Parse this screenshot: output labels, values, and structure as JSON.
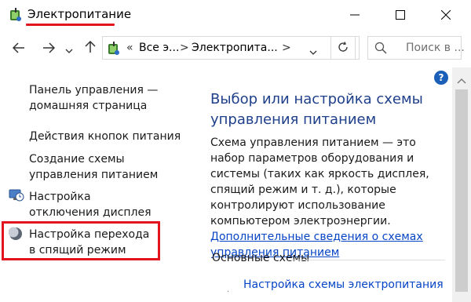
{
  "window": {
    "title": "Электропитание",
    "accent_color": "#e2151e",
    "controls": {
      "minimize_icon": "minimize-icon",
      "maximize_icon": "maximize-icon",
      "close_icon": "close-icon"
    }
  },
  "address": {
    "separator": "«",
    "segment_1": "Все э...",
    "arrow": ">",
    "segment_2": "Электропита...",
    "search_placeholder": "Поиск в ..."
  },
  "sidebar": {
    "home_link": "Панель управления — домашняя страница",
    "items": [
      {
        "label": "Действия кнопок питания"
      },
      {
        "label": "Создание схемы управления питанием"
      },
      {
        "label": "Настройка отключения дисплея",
        "icon": "display-clock-icon"
      },
      {
        "label": "Настройка перехода в спящий режим",
        "icon": "moon-icon",
        "highlighted": true
      }
    ]
  },
  "main": {
    "help_label": "?",
    "heading": "Выбор или настройка схемы управления питанием",
    "description": "Схема управления питанием — это набор параметров оборудования и системы (таких как яркость дисплея, спящий режим и т. д.), которые контролируют использование компьютером электроэнергии.",
    "description_link": "Дополнительные сведения о схемах управления питанием",
    "section_title": "Основные схемы",
    "plan_link": "Настройка схемы электропитания"
  }
}
